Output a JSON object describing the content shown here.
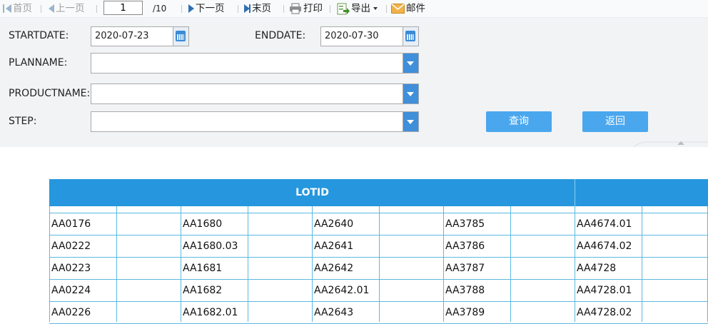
{
  "toolbar": {
    "first": "首页",
    "prev": "上一页",
    "page_current": "1",
    "page_total": "/10",
    "next": "下一页",
    "last": "末页",
    "print": "打印",
    "export": "导出",
    "mail": "邮件"
  },
  "form": {
    "startdate_label": "STARTDATE:",
    "startdate_value": "2020-07-23",
    "enddate_label": "ENDDATE:",
    "enddate_value": "2020-07-30",
    "planname_label": "PLANNAME:",
    "productname_label": "PRODUCTNAME:",
    "step_label": "STEP:",
    "query_label": "查询",
    "back_label": "返回"
  },
  "table": {
    "header": "LOTID",
    "rows": [
      [
        "AA0176",
        "AA1680",
        "AA2640",
        "AA3785",
        "AA4674.01"
      ],
      [
        "AA0222",
        "AA1680.03",
        "AA2641",
        "AA3786",
        "AA4674.02"
      ],
      [
        "AA0223",
        "AA1681",
        "AA2642",
        "AA3787",
        "AA4728"
      ],
      [
        "AA0224",
        "AA1682",
        "AA2642.01",
        "AA3788",
        "AA4728.01"
      ],
      [
        "AA0226",
        "AA1682.01",
        "AA2643",
        "AA3789",
        "AA4728.02"
      ]
    ]
  },
  "colors": {
    "header_bg": "#2697de",
    "button_bg": "#4aa7ee",
    "grid_line": "#5bb9e0"
  }
}
